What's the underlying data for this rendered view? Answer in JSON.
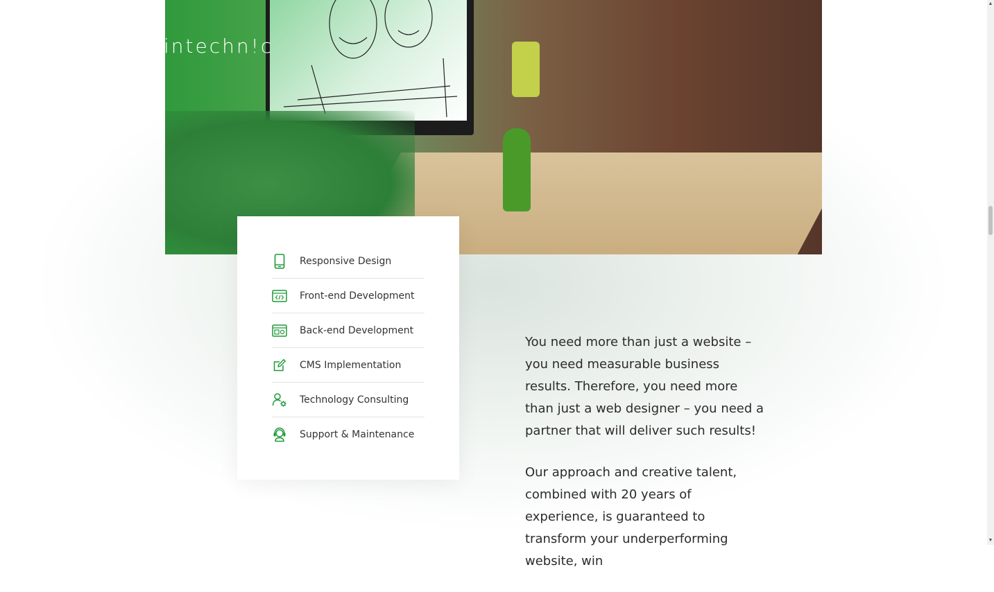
{
  "brand": {
    "logo_text": "intechn!c",
    "accent_color": "#1f9a3a"
  },
  "header": {
    "menu_icon": "hamburger-menu-icon"
  },
  "services": {
    "items": [
      {
        "label": "Responsive Design",
        "icon": "mobile-device-icon"
      },
      {
        "label": "Front-end Development",
        "icon": "code-window-icon"
      },
      {
        "label": "Back-end Development",
        "icon": "server-settings-icon"
      },
      {
        "label": "CMS Implementation",
        "icon": "edit-pencil-icon"
      },
      {
        "label": "Technology Consulting",
        "icon": "user-gear-icon"
      },
      {
        "label": "Support & Maintenance",
        "icon": "headset-support-icon"
      }
    ]
  },
  "intro": {
    "paragraph_1": "You need more than just a website – you need measurable business results. Therefore, you need more than just a web designer – you need a partner that will deliver such results!",
    "paragraph_2": "Our approach and creative talent, combined with 20 years of experience, is guaranteed to transform your underperforming website, win"
  },
  "scrollbar": {
    "up_arrow": "▲",
    "down_arrow": "▼"
  }
}
